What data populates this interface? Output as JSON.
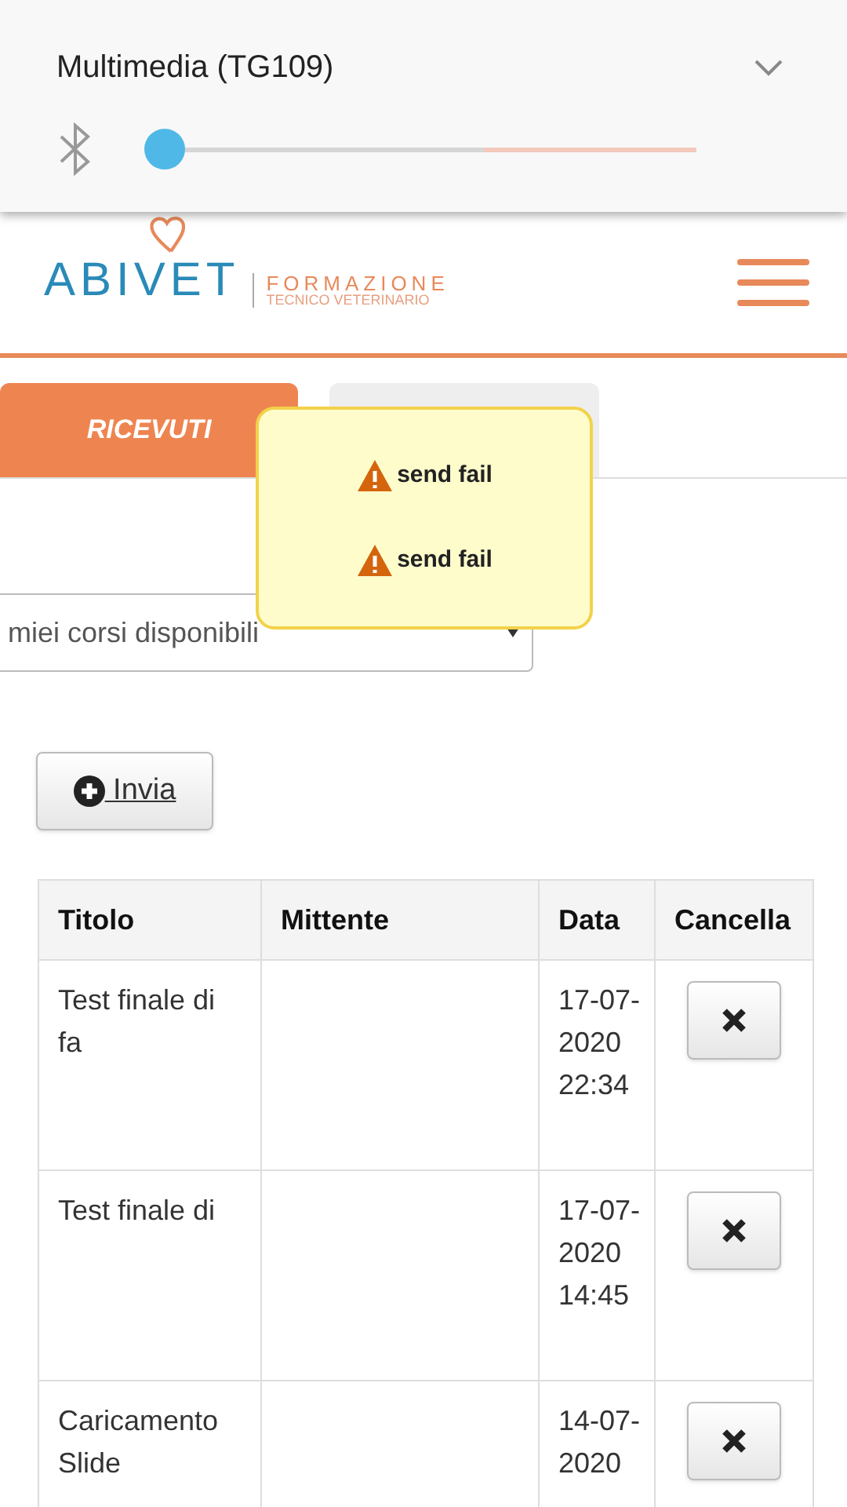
{
  "notification": {
    "title": "Multimedia (TG109)",
    "volume": {
      "level": 0.0
    }
  },
  "header": {
    "logo": {
      "brand": "ABIVET",
      "line1": "FORMAZIONE",
      "line2": "TECNICO VETERINARIO"
    }
  },
  "tabs": [
    {
      "label": "RICEVUTI",
      "selected": true
    },
    {
      "selected": false
    }
  ],
  "toasts": [
    "send fail",
    "send fail"
  ],
  "course_select": {
    "value": "miei corsi disponibili"
  },
  "send_button": {
    "label": " Invia"
  },
  "table": {
    "columns": [
      "Titolo",
      "Mittente",
      "Data",
      "Cancella"
    ],
    "rows": [
      {
        "title": "Test finale di fa",
        "date": "17-07-2020 22:34"
      },
      {
        "title": "Test finale di",
        "date": "17-07-2020 14:45"
      },
      {
        "title": "Caricamento Slide",
        "date": "14-07-2020"
      }
    ]
  }
}
